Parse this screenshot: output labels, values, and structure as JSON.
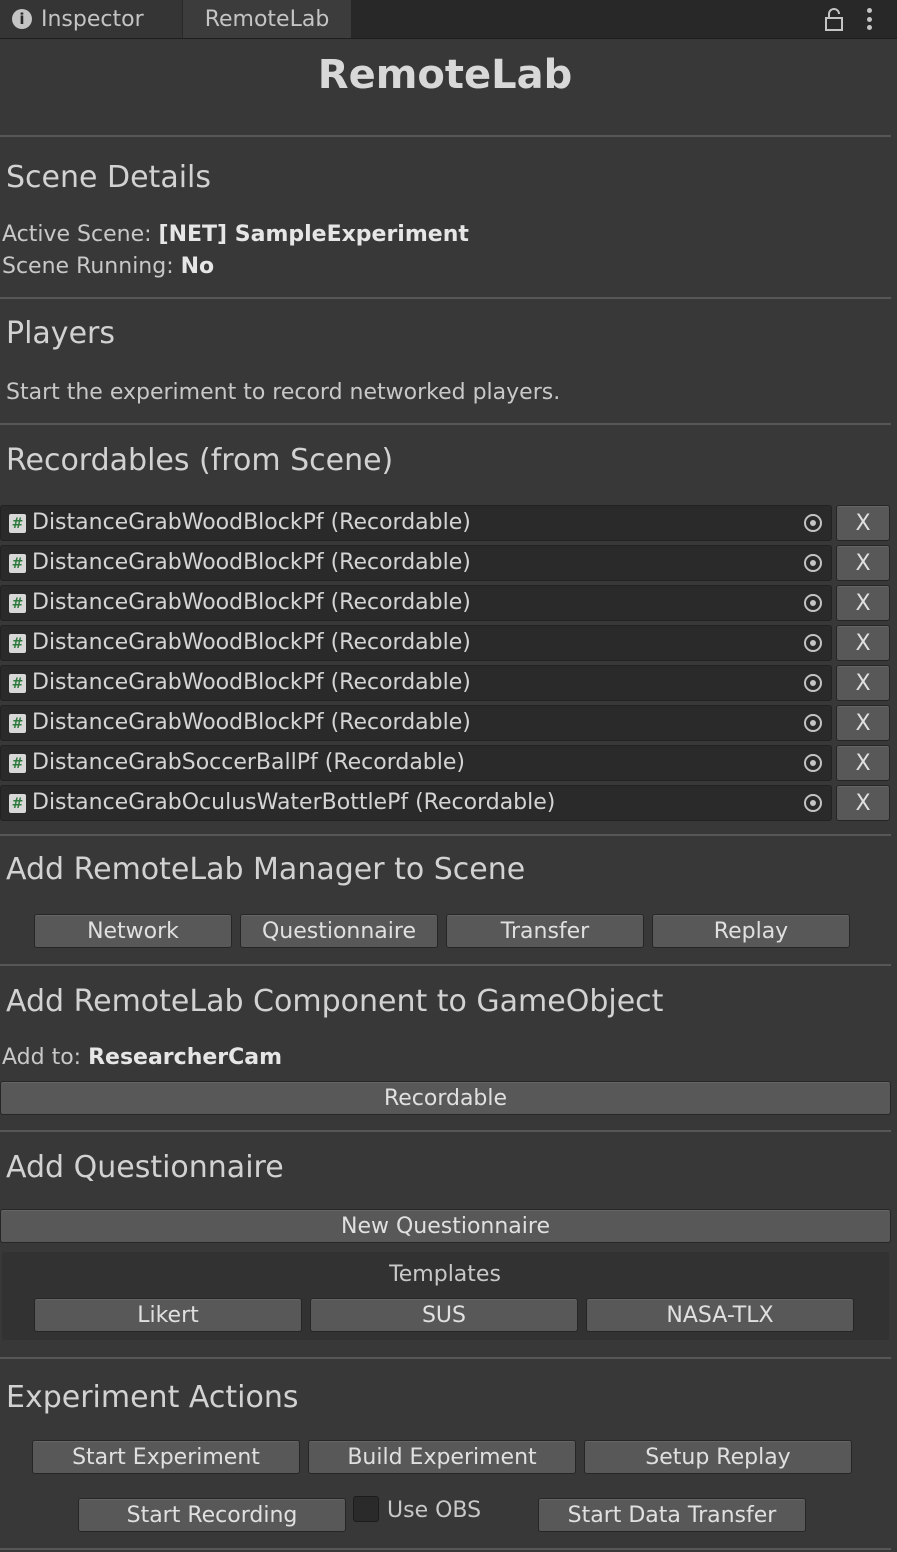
{
  "tabs": {
    "inspector": "Inspector",
    "remotelab": "RemoteLab"
  },
  "title": "RemoteLab",
  "scene_details": {
    "heading": "Scene Details",
    "active_label": "Active Scene: ",
    "active_value": "[NET] SampleExperiment",
    "running_label": "Scene Running: ",
    "running_value": "No"
  },
  "players": {
    "heading": "Players",
    "message": "Start the experiment to record networked players."
  },
  "recordables": {
    "heading": "Recordables (from Scene)",
    "remove_label": "X",
    "items": [
      "DistanceGrabWoodBlockPf (Recordable)",
      "DistanceGrabWoodBlockPf (Recordable)",
      "DistanceGrabWoodBlockPf (Recordable)",
      "DistanceGrabWoodBlockPf (Recordable)",
      "DistanceGrabWoodBlockPf (Recordable)",
      "DistanceGrabWoodBlockPf (Recordable)",
      "DistanceGrabSoccerBallPf (Recordable)",
      "DistanceGrabOculusWaterBottlePf (Recordable)"
    ]
  },
  "manager": {
    "heading": "Add RemoteLab Manager to Scene",
    "buttons": [
      "Network",
      "Questionnaire",
      "Transfer",
      "Replay"
    ]
  },
  "component": {
    "heading": "Add RemoteLab Component to GameObject",
    "add_to_label": "Add to: ",
    "add_to_value": "ResearcherCam",
    "button": "Recordable"
  },
  "questionnaire": {
    "heading": "Add Questionnaire",
    "new_button": "New Questionnaire",
    "templates_label": "Templates",
    "templates": [
      "Likert",
      "SUS",
      "NASA-TLX"
    ]
  },
  "actions": {
    "heading": "Experiment Actions",
    "start_experiment": "Start Experiment",
    "build_experiment": "Build Experiment",
    "setup_replay": "Setup Replay",
    "start_recording": "Start Recording",
    "use_obs": "Use OBS",
    "start_data_transfer": "Start Data Transfer"
  },
  "icons": {
    "tab_info": "info-icon",
    "lock": "lock-icon",
    "menu": "kebab-menu-icon",
    "script": "script-icon",
    "object_picker": "target-icon"
  },
  "colors": {
    "background": "#383838",
    "button": "#585858",
    "row": "#2a2a2a",
    "script_icon": "#2f7a3e"
  }
}
